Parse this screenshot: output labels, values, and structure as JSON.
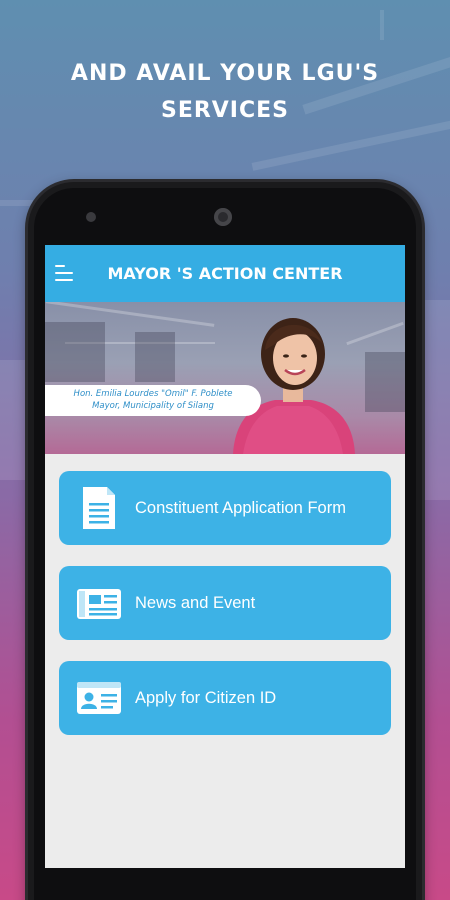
{
  "promo": {
    "headline_line1": "AND AVAIL YOUR LGU'S",
    "headline_line2": "SERVICES"
  },
  "app": {
    "title": "MAYOR 'S ACTION CENTER",
    "menu_icon": "hamburger-menu-icon",
    "accent_color": "#35ade3",
    "card_color": "#3db2e6"
  },
  "banner": {
    "caption_line1": "Hon. Emilia Lourdes \"Omil\" F. Poblete",
    "caption_line2": "Mayor, Municipality of Silang"
  },
  "menu": [
    {
      "label": "Constituent Application Form",
      "icon": "document-icon"
    },
    {
      "label": "News and Event",
      "icon": "newspaper-icon"
    },
    {
      "label": "Apply for Citizen ID",
      "icon": "id-card-icon"
    }
  ]
}
